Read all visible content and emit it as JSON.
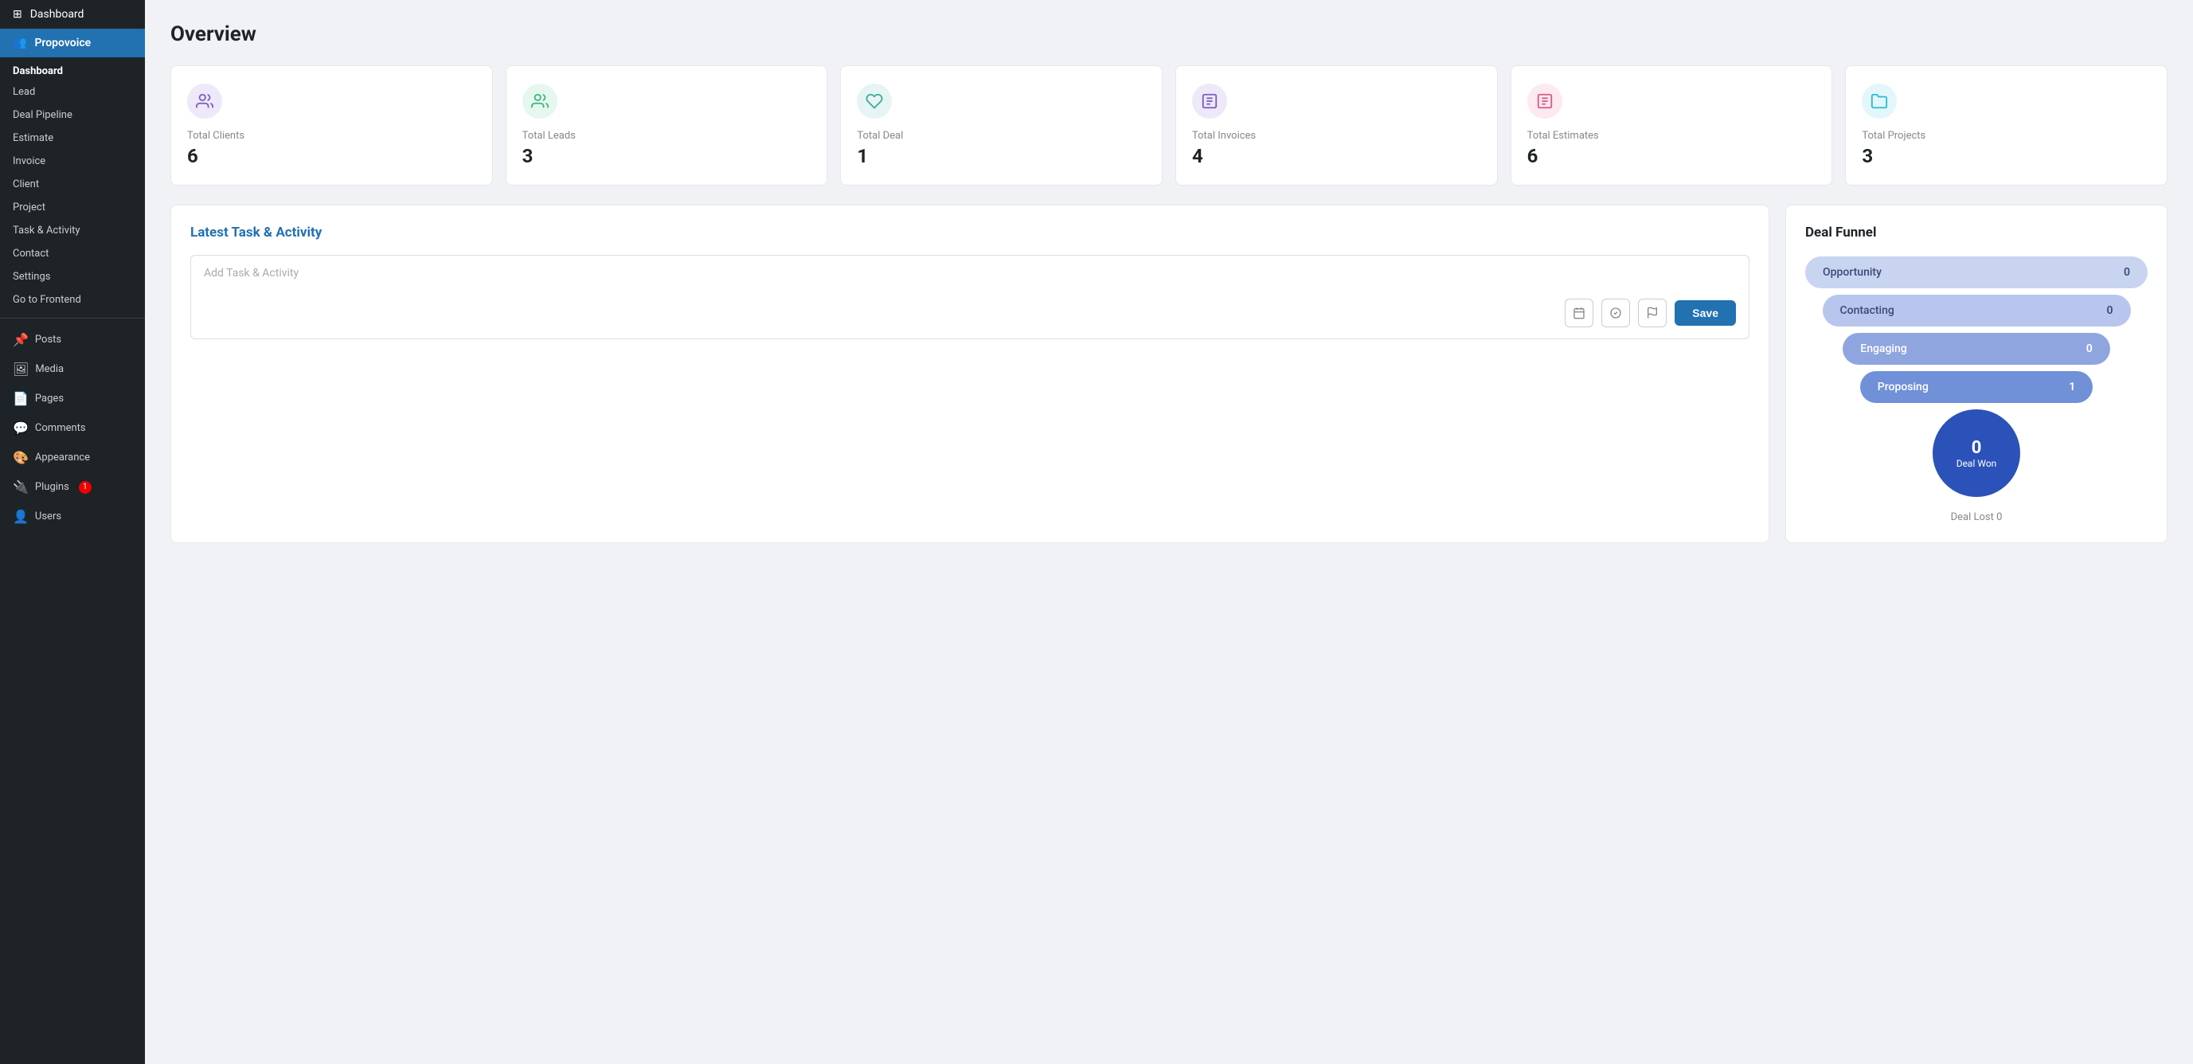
{
  "sidebar": {
    "top_items": [
      {
        "id": "dashboard-wp",
        "label": "Dashboard",
        "icon": "⊞"
      },
      {
        "id": "propovoice",
        "label": "Propovoice",
        "icon": "👥"
      }
    ],
    "dashboard_label": "Dashboard",
    "nav_items": [
      {
        "id": "lead",
        "label": "Lead"
      },
      {
        "id": "deal-pipeline",
        "label": "Deal Pipeline"
      },
      {
        "id": "estimate",
        "label": "Estimate"
      },
      {
        "id": "invoice",
        "label": "Invoice"
      },
      {
        "id": "client",
        "label": "Client"
      },
      {
        "id": "project",
        "label": "Project"
      },
      {
        "id": "task-activity",
        "label": "Task & Activity"
      },
      {
        "id": "contact",
        "label": "Contact"
      },
      {
        "id": "settings",
        "label": "Settings"
      },
      {
        "id": "goto-frontend",
        "label": "Go to Frontend"
      }
    ],
    "section_items": [
      {
        "id": "posts",
        "label": "Posts",
        "icon": "📌"
      },
      {
        "id": "media",
        "label": "Media",
        "icon": "🖼"
      },
      {
        "id": "pages",
        "label": "Pages",
        "icon": "📄"
      },
      {
        "id": "comments",
        "label": "Comments",
        "icon": "💬"
      },
      {
        "id": "appearance",
        "label": "Appearance",
        "icon": "🎨"
      },
      {
        "id": "plugins",
        "label": "Plugins",
        "icon": "🔌",
        "badge": "1"
      },
      {
        "id": "users",
        "label": "Users",
        "icon": "👤"
      }
    ]
  },
  "page": {
    "title": "Overview"
  },
  "stat_cards": [
    {
      "id": "total-clients",
      "label": "Total Clients",
      "value": "6",
      "icon_class": "icon-purple",
      "icon": "👤"
    },
    {
      "id": "total-leads",
      "label": "Total Leads",
      "value": "3",
      "icon_class": "icon-green",
      "icon": "👥"
    },
    {
      "id": "total-deal",
      "label": "Total Deal",
      "value": "1",
      "icon_class": "icon-teal",
      "icon": "🤝"
    },
    {
      "id": "total-invoices",
      "label": "Total Invoices",
      "value": "4",
      "icon_class": "icon-violet",
      "icon": "📋"
    },
    {
      "id": "total-estimates",
      "label": "Total Estimates",
      "value": "6",
      "icon_class": "icon-pink",
      "icon": "📝"
    },
    {
      "id": "total-projects",
      "label": "Total Projects",
      "value": "3",
      "icon_class": "icon-cyan",
      "icon": "📁"
    }
  ],
  "task_section": {
    "title": "Latest Task & Activity",
    "input_placeholder": "Add Task & Activity",
    "save_label": "Save"
  },
  "funnel_section": {
    "title": "Deal Funnel",
    "stages": [
      {
        "id": "opportunity",
        "label": "Opportunity",
        "count": "0"
      },
      {
        "id": "contacting",
        "label": "Contacting",
        "count": "0"
      },
      {
        "id": "engaging",
        "label": "Engaging",
        "count": "0"
      },
      {
        "id": "proposing",
        "label": "Proposing",
        "count": "1"
      },
      {
        "id": "deal-won",
        "label": "Deal Won",
        "count": "0"
      }
    ],
    "deal_lost_label": "Deal Lost",
    "deal_lost_value": "0"
  }
}
